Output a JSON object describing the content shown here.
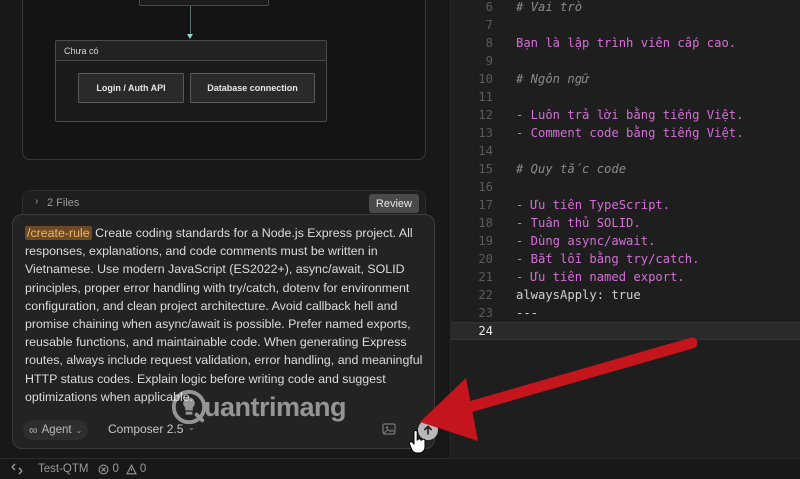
{
  "diagram": {
    "group_title": "Chưa có",
    "nodes": [
      "Login / Auth API",
      "Database connection"
    ]
  },
  "files_bar": {
    "label": "2 Files",
    "review_label": "Review"
  },
  "composer": {
    "rule_chip": "/create-rule",
    "prompt": " Create coding standards for a Node.js Express project. All responses, explanations, and code comments must be written in Vietnamese. Use modern JavaScript (ES2022+), async/await, SOLID principles, proper error handling with try/catch, dotenv for environment configuration, and clean project architecture. Avoid callback hell and promise chaining when async/await is possible. Prefer named exports, reusable functions, and maintainable code. When generating Express routes, always include request validation, error handling, and meaningful HTTP status codes. Explain logic before writing code and suggest optimizations when applicable.",
    "mode_label": "Agent",
    "model_label": "Composer 2.5",
    "icons": {
      "mode": "infinity-icon",
      "send": "arrow-up-icon",
      "attach": "image-icon"
    }
  },
  "watermark": {
    "text": "uantrimang"
  },
  "editor": {
    "lines": [
      {
        "no": "6",
        "text": "# Vai trò",
        "kind": "comment"
      },
      {
        "no": "7",
        "text": "",
        "kind": "plain"
      },
      {
        "no": "8",
        "text": "Bạn là lập trình viên cấp cao.",
        "kind": "magenta"
      },
      {
        "no": "9",
        "text": "",
        "kind": "plain"
      },
      {
        "no": "10",
        "text": "# Ngôn ngữ",
        "kind": "comment"
      },
      {
        "no": "11",
        "text": "",
        "kind": "plain"
      },
      {
        "no": "12",
        "text": "- Luôn trả lời bằng tiếng Việt.",
        "kind": "magenta"
      },
      {
        "no": "13",
        "text": "- Comment code bằng tiếng Việt.",
        "kind": "magenta"
      },
      {
        "no": "14",
        "text": "",
        "kind": "plain"
      },
      {
        "no": "15",
        "text": "# Quy tắc code",
        "kind": "comment"
      },
      {
        "no": "16",
        "text": "",
        "kind": "plain"
      },
      {
        "no": "17",
        "text": "- Ưu tiên TypeScript.",
        "kind": "magenta"
      },
      {
        "no": "18",
        "text": "- Tuân thủ SOLID.",
        "kind": "magenta"
      },
      {
        "no": "19",
        "text": "- Dùng async/await.",
        "kind": "magenta"
      },
      {
        "no": "20",
        "text": "- Bắt lỗi bằng try/catch.",
        "kind": "magenta"
      },
      {
        "no": "21",
        "text": "- Ưu tiên named export.",
        "kind": "magenta"
      },
      {
        "no": "22",
        "text": "alwaysApply: true",
        "kind": "plain"
      },
      {
        "no": "23",
        "text": "---",
        "kind": "plain"
      },
      {
        "no": "24",
        "text": "",
        "kind": "current"
      }
    ]
  },
  "statusbar": {
    "workspace": "Test-QTM",
    "errors": "0",
    "warnings": "0"
  },
  "colors": {
    "accent_chip": "#f0b56a",
    "code_magenta": "#d46fd6",
    "annotation_arrow": "#c4141c"
  }
}
